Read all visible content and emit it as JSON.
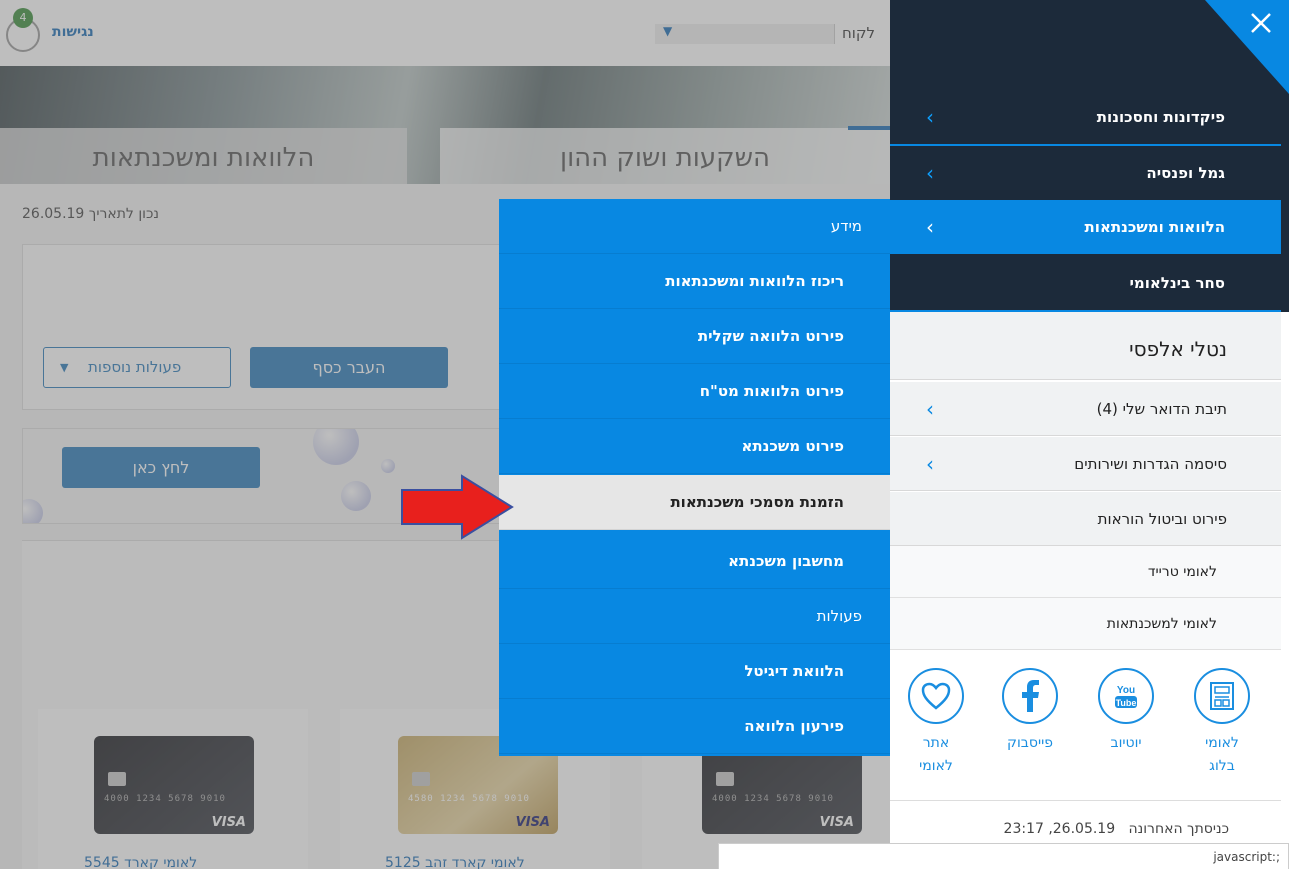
{
  "header": {
    "accessibility_link": "נגישות",
    "notification_count": "4",
    "customer_label": "לקוח"
  },
  "tabs": [
    {
      "label": "השקעות ושוק ההון"
    },
    {
      "label": "הלוואות ומשכנתאות"
    }
  ],
  "content": {
    "date_label": "נכון לתאריך",
    "date_value": "26.05.19",
    "transfer_button": "העבר כסף",
    "more_actions_button": "פעולות נוספות",
    "click_here_button": "לחץ כאן",
    "card_captions": [
      "לאומי קארד זהב 5125",
      "לאומי קארד 5545"
    ]
  },
  "sidebar": {
    "nav": [
      {
        "label": "פיקדונות וחסכונות"
      },
      {
        "label": "גמל ופנסיה"
      },
      {
        "label": "הלוואות ומשכנתאות",
        "active": true
      },
      {
        "label": "סחר בינלאומי"
      }
    ],
    "user_name": "נטלי אלפסי",
    "items": [
      {
        "label": "תיבת הדואר שלי (4)"
      },
      {
        "label": "סיסמה הגדרות ושירותים"
      },
      {
        "label": "פירוט וביטול הוראות"
      }
    ],
    "links": [
      {
        "label": "לאומי טרייד"
      },
      {
        "label": "לאומי למשכנתאות"
      }
    ],
    "social": [
      {
        "line1": "לאומי",
        "line2": "בלוג",
        "icon": "blog-icon"
      },
      {
        "line1": "יוטיוב",
        "line2": "",
        "icon": "youtube-icon"
      },
      {
        "line1": "פייסבוק",
        "line2": "",
        "icon": "facebook-icon"
      },
      {
        "line1": "אתר",
        "line2": "לאומי",
        "icon": "heart-icon"
      }
    ],
    "last_login_label": "כניסתך האחרונה",
    "last_login_value": "23:17 ,26.05.19"
  },
  "submenu": {
    "section_info": "מידע",
    "info_items": [
      "ריכוז הלוואות ומשכנתאות",
      "פירוט הלוואה שקלית",
      "פירוט הלוואות מט\"ח",
      "פירוט משכנתא",
      "הזמנת מסמכי משכנתאות",
      "מחשבון משכנתא"
    ],
    "section_actions": "פעולות",
    "action_items": [
      "הלוואת דיגיטל",
      "פירעון הלוואה"
    ]
  },
  "status_bar": "javascript:;",
  "colors": {
    "accent_blue": "#0888e2",
    "dark_nav": "#1c2a3a",
    "highlight_item": "#e6e6e6",
    "arrow_red": "#e8201d"
  }
}
